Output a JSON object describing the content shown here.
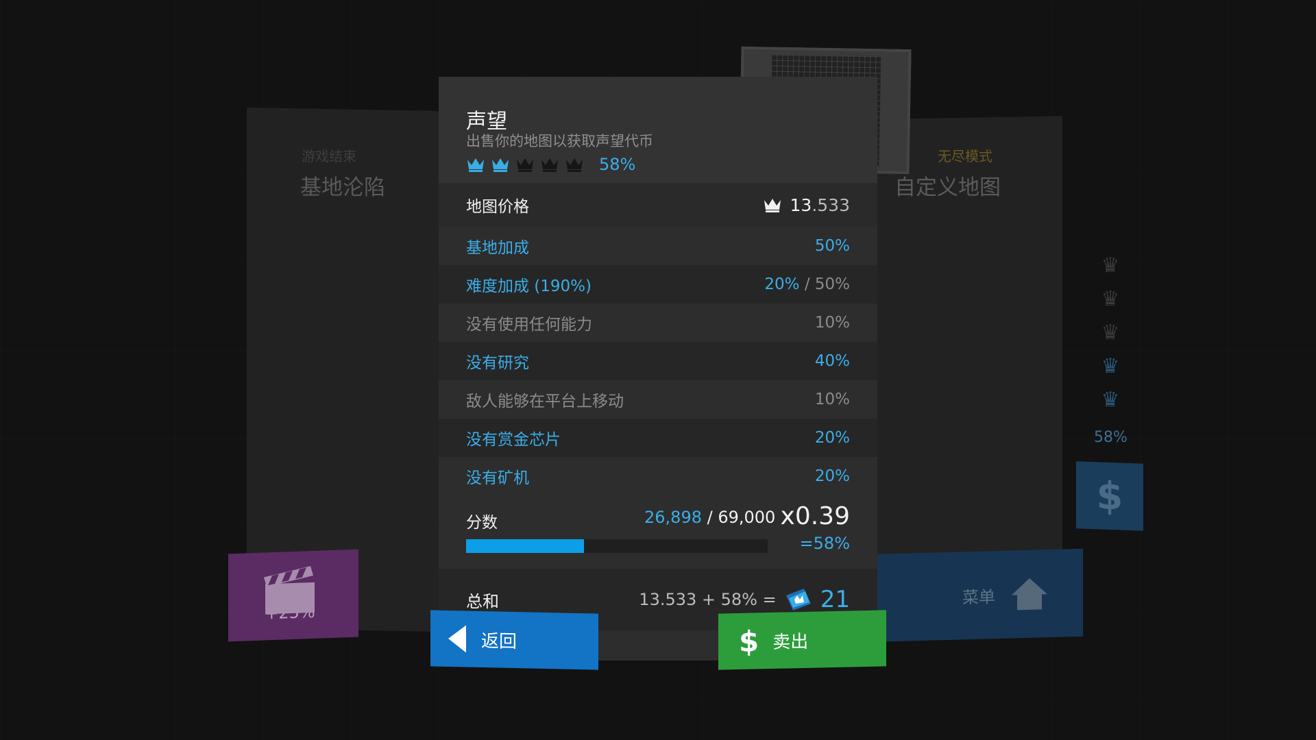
{
  "background": {
    "left_panel": {
      "subtitle": "游戏结束",
      "title": "基地沦陷",
      "ad_label": "+25%"
    },
    "right_panel": {
      "subtitle": "无尽模式",
      "title": "自定义地图"
    },
    "menu_label": "菜单",
    "side_rating_pct": "58%",
    "side_crowns_filled": 2
  },
  "dialog": {
    "title": "声望",
    "subtitle": "出售你的地图以获取声望代币",
    "rating": {
      "crowns_total": 5,
      "crowns_filled": 2,
      "percent_label": "58%"
    },
    "map_price": {
      "label": "地图价格",
      "whole": "13",
      "fraction": ".533",
      "icon": "crown-icon"
    },
    "bonuses": [
      {
        "label": "基地加成",
        "value": "50%",
        "active": true
      },
      {
        "label": "难度加成 (190%)",
        "value": "20%",
        "max": "/ 50%",
        "active": true
      },
      {
        "label": "没有使用任何能力",
        "value": "10%",
        "active": false
      },
      {
        "label": "没有研究",
        "value": "40%",
        "active": true
      },
      {
        "label": "敌人能够在平台上移动",
        "value": "10%",
        "active": false
      },
      {
        "label": "没有赏金芯片",
        "value": "20%",
        "active": true
      },
      {
        "label": "没有矿机",
        "value": "20%",
        "active": true
      }
    ],
    "score": {
      "label": "分数",
      "current": "26,898",
      "target": "/ 69,000",
      "progress": 0.39,
      "multiplier": "x0.39",
      "multiplier_pct": "=58%"
    },
    "total": {
      "label": "总和",
      "formula": "13.533 + 58% =",
      "value": "21",
      "icon": "prestige-token-icon"
    },
    "buttons": {
      "back": "返回",
      "sell": "卖出"
    }
  },
  "colors": {
    "accent_blue": "#3aaee8",
    "back_button": "#1373c5",
    "sell_button": "#2d9d3c"
  }
}
